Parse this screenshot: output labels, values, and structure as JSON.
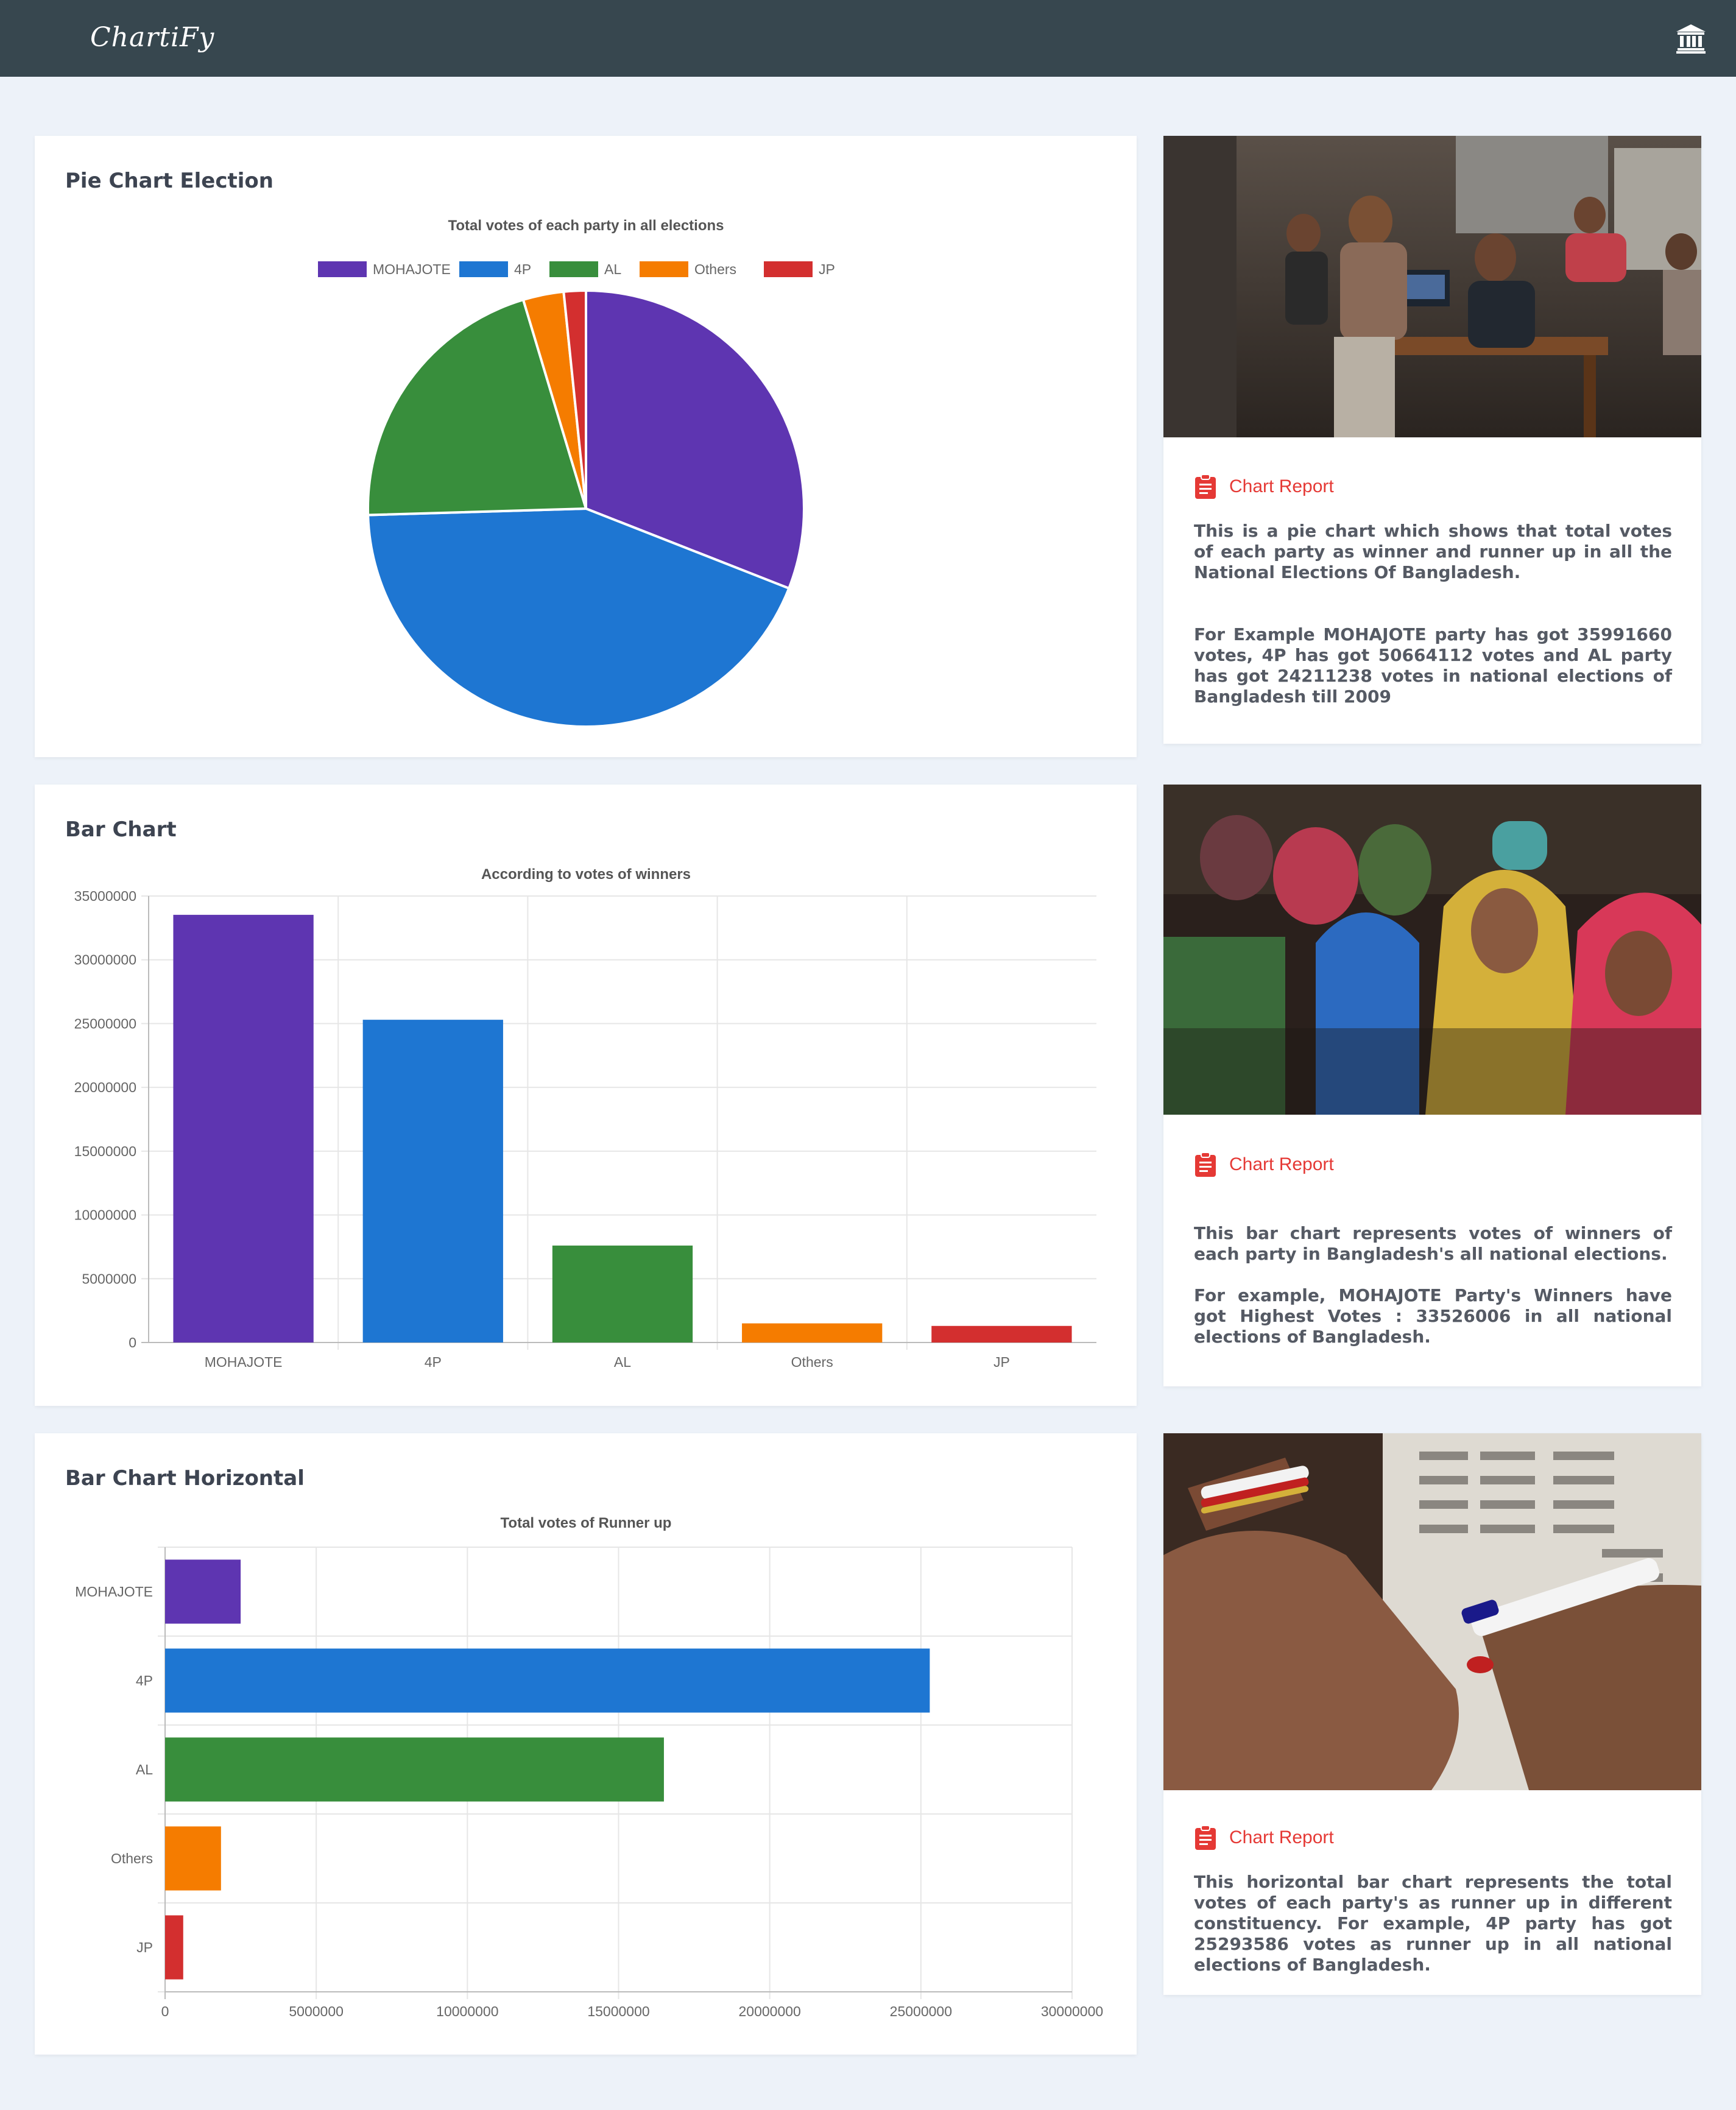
{
  "app": {
    "brand": "ChartiFy"
  },
  "colors": {
    "navbar": "#37474f",
    "background": "#edf2f9",
    "accent": "#e53935",
    "MOHAJOTE": "#5e35b1",
    "4P": "#1e76d2",
    "AL": "#388e3c",
    "Others": "#f57c00",
    "JP": "#d32f2f"
  },
  "icons": {
    "nav": "institution-icon",
    "report": "clipboard-icon"
  },
  "pie_card": {
    "title": "Pie Chart Election"
  },
  "bar_card": {
    "title": "Bar Chart"
  },
  "hbar_card": {
    "title": "Bar Chart Horizontal"
  },
  "chart_data": [
    {
      "type": "pie",
      "title": "Total votes of each party in all elections",
      "legend": "top",
      "categories": [
        "MOHAJOTE",
        "4P",
        "AL",
        "Others",
        "JP"
      ],
      "values": [
        35991660,
        50664112,
        24211238,
        3500000,
        1900000
      ]
    },
    {
      "type": "bar",
      "title": "According to votes of winners",
      "categories": [
        "MOHAJOTE",
        "4P",
        "AL",
        "Others",
        "JP"
      ],
      "values": [
        33526006,
        25300000,
        7600000,
        1500000,
        1300000
      ],
      "ylim": [
        0,
        35000000
      ],
      "yticks": [
        "0",
        "5000000",
        "10000000",
        "15000000",
        "20000000",
        "25000000",
        "30000000",
        "35000000"
      ],
      "grid": true
    },
    {
      "type": "bar",
      "orientation": "horizontal",
      "title": "Total votes of Runner up",
      "categories": [
        "MOHAJOTE",
        "4P",
        "AL",
        "Others",
        "JP"
      ],
      "values": [
        2500000,
        25293586,
        16500000,
        1850000,
        600000
      ],
      "xlim": [
        0,
        30000000
      ],
      "xticks": [
        "0",
        "5000000",
        "10000000",
        "15000000",
        "20000000",
        "25000000",
        "30000000"
      ],
      "grid": true
    }
  ],
  "reports": [
    {
      "label": "Chart Report",
      "paragraphs": [
        "This is a pie chart which shows that total votes of each party as winner and runner up in all the National Elections Of Bangladesh.",
        "For Example MOHAJOTE party has got 35991660 votes, 4P has got 50664112 votes and AL party has got 24211238 votes in national elections of Bangladesh till 2009"
      ]
    },
    {
      "label": "Chart Report",
      "paragraphs": [
        "This bar chart represents votes of winners of each party in Bangladesh's all national elections.",
        "For example, MOHAJOTE Party's Winners have got Highest Votes : 33526006 in all national elections of Bangladesh."
      ]
    },
    {
      "label": "Chart Report",
      "paragraphs": [
        "This horizontal bar chart represents the total votes of each party's as runner up in different constituency. For example, 4P party has got 25293586 votes as runner up in all national elections of Bangladesh."
      ]
    }
  ]
}
